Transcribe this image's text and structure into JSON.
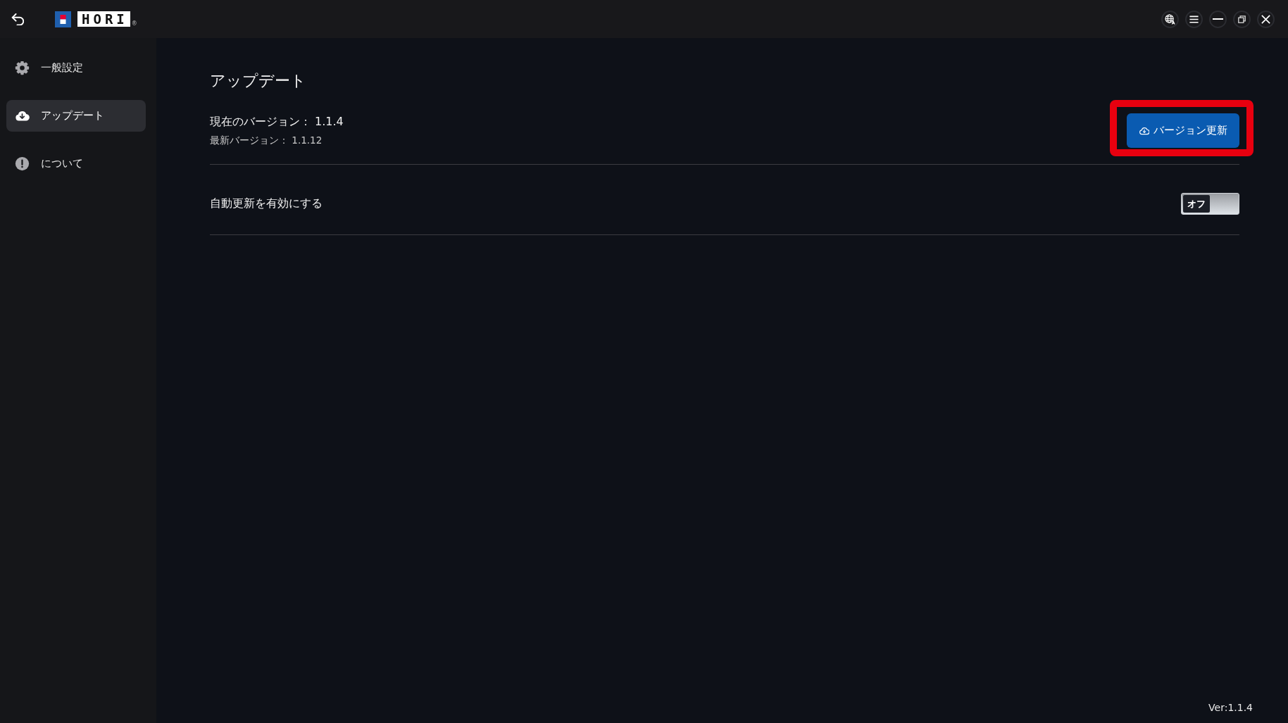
{
  "title_bar": {
    "brand": "HORI",
    "brand_mark": "®"
  },
  "sidebar": {
    "items": [
      {
        "label": "一般設定",
        "selected": false
      },
      {
        "label": "アップデート",
        "selected": true
      },
      {
        "label": "について",
        "selected": false
      }
    ]
  },
  "content": {
    "title": "アップデート",
    "current_version": "現在のバージョン： 1.1.4",
    "latest_version": "最新バージョン： 1.1.12",
    "update_button": {
      "label": "バージョン更新",
      "highlighted": true
    },
    "auto_update": {
      "label": "自動更新を有効にする",
      "on": false,
      "state_label": "オフ"
    }
  },
  "footer": {
    "version": "Ver:1.1.4"
  }
}
